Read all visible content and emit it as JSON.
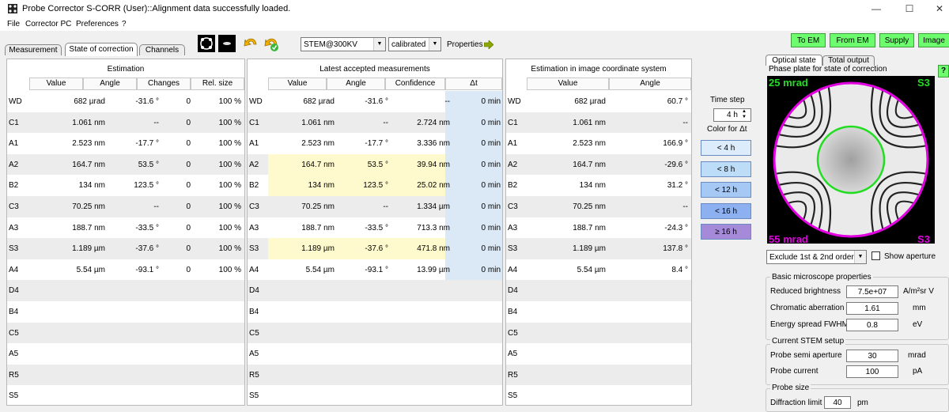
{
  "window": {
    "title": "Probe Corrector S-CORR (User)::Alignment data successfully loaded."
  },
  "menu": [
    "File",
    "Corrector PC",
    "Preferences",
    "?"
  ],
  "tabs": {
    "measurement": "Measurement",
    "state": "State of correction",
    "channels": "Channels"
  },
  "toolbar": {
    "mode": "STEM@300KV",
    "calibration": "calibrated",
    "properties": "Properties",
    "to_em": "To EM",
    "from_em": "From EM",
    "supply": "Supply",
    "image": "Image"
  },
  "estimation": {
    "title": "Estimation",
    "headers": [
      "Value",
      "Angle",
      "Changes",
      "Rel. size"
    ],
    "rows": [
      [
        "WD",
        "682 µrad",
        "-31.6 °",
        "0",
        "100 %"
      ],
      [
        "C1",
        "1.061 nm",
        "--",
        "0",
        "100 %"
      ],
      [
        "A1",
        "2.523 nm",
        "-17.7 °",
        "0",
        "100 %"
      ],
      [
        "A2",
        "164.7 nm",
        "53.5 °",
        "0",
        "100 %"
      ],
      [
        "B2",
        "134 nm",
        "123.5 °",
        "0",
        "100 %"
      ],
      [
        "C3",
        "70.25 nm",
        "--",
        "0",
        "100 %"
      ],
      [
        "A3",
        "188.7 nm",
        "-33.5 °",
        "0",
        "100 %"
      ],
      [
        "S3",
        "1.189 µm",
        "-37.6 °",
        "0",
        "100 %"
      ],
      [
        "A4",
        "5.54 µm",
        "-93.1 °",
        "0",
        "100 %"
      ],
      [
        "D4",
        "",
        "",
        "",
        ""
      ],
      [
        "B4",
        "",
        "",
        "",
        ""
      ],
      [
        "C5",
        "",
        "",
        "",
        ""
      ],
      [
        "A5",
        "",
        "",
        "",
        ""
      ],
      [
        "R5",
        "",
        "",
        "",
        ""
      ],
      [
        "S5",
        "",
        "",
        "",
        ""
      ]
    ]
  },
  "latest": {
    "title": "Latest accepted measurements",
    "headers": [
      "Value",
      "Angle",
      "Confidence",
      "Δt"
    ],
    "rows": [
      [
        "WD",
        "682 µrad",
        "-31.6 °",
        "--",
        "0 min"
      ],
      [
        "C1",
        "1.061 nm",
        "--",
        "2.724 nm",
        "0 min"
      ],
      [
        "A1",
        "2.523 nm",
        "-17.7 °",
        "3.336 nm",
        "0 min"
      ],
      [
        "A2",
        "164.7 nm",
        "53.5 °",
        "39.94 nm",
        "0 min"
      ],
      [
        "B2",
        "134 nm",
        "123.5 °",
        "25.02 nm",
        "0 min"
      ],
      [
        "C3",
        "70.25 nm",
        "--",
        "1.334 µm",
        "0 min"
      ],
      [
        "A3",
        "188.7 nm",
        "-33.5 °",
        "713.3 nm",
        "0 min"
      ],
      [
        "S3",
        "1.189 µm",
        "-37.6 °",
        "471.8 nm",
        "0 min"
      ],
      [
        "A4",
        "5.54 µm",
        "-93.1 °",
        "13.99 µm",
        "0 min"
      ],
      [
        "D4",
        "",
        "",
        "",
        ""
      ],
      [
        "B4",
        "",
        "",
        "",
        ""
      ],
      [
        "C5",
        "",
        "",
        "",
        ""
      ],
      [
        "A5",
        "",
        "",
        "",
        ""
      ],
      [
        "R5",
        "",
        "",
        "",
        ""
      ],
      [
        "S5",
        "",
        "",
        "",
        ""
      ]
    ]
  },
  "image_coord": {
    "title": "Estimation in image coordinate system",
    "headers": [
      "Value",
      "Angle"
    ],
    "rows": [
      [
        "WD",
        "682 µrad",
        "60.7 °"
      ],
      [
        "C1",
        "1.061 nm",
        "--"
      ],
      [
        "A1",
        "2.523 nm",
        "166.9 °"
      ],
      [
        "A2",
        "164.7 nm",
        "-29.6 °"
      ],
      [
        "B2",
        "134 nm",
        "31.2 °"
      ],
      [
        "C3",
        "70.25 nm",
        "--"
      ],
      [
        "A3",
        "188.7 nm",
        "-24.3 °"
      ],
      [
        "S3",
        "1.189 µm",
        "137.8 °"
      ],
      [
        "A4",
        "5.54 µm",
        "8.4 °"
      ],
      [
        "D4",
        "",
        ""
      ],
      [
        "B4",
        "",
        ""
      ],
      [
        "C5",
        "",
        ""
      ],
      [
        "A5",
        "",
        ""
      ],
      [
        "R5",
        "",
        ""
      ],
      [
        "S5",
        "",
        ""
      ]
    ]
  },
  "timestep": {
    "label": "Time step",
    "value": "4 h",
    "color_label": "Color for Δt",
    "buttons": [
      {
        "label": "< 4 h",
        "color": "#dcecfb"
      },
      {
        "label": "< 8 h",
        "color": "#bcdcf8"
      },
      {
        "label": "< 12 h",
        "color": "#a6c8f4"
      },
      {
        "label": "< 16 h",
        "color": "#8cb0f0"
      },
      {
        "label": "≥ 16 h",
        "color": "#a48ad8"
      }
    ]
  },
  "right": {
    "tab_optical": "Optical state",
    "tab_total": "Total output",
    "phase_title": "Phase plate for state of correction",
    "help": "?",
    "mrad_top": "25 mrad",
    "mrad_bottom": "55 mrad",
    "s3_top": "S3",
    "s3_bottom": "S3",
    "exclude": "Exclude 1st & 2nd order",
    "show_aperture": "Show aperture",
    "basic_title": "Basic microscope properties",
    "reduced_brightness_label": "Reduced brightness",
    "reduced_brightness": "7.5e+07",
    "reduced_brightness_unit": "A/m²sr V",
    "chromatic_label": "Chromatic aberration",
    "chromatic": "1.61",
    "chromatic_unit": "mm",
    "energy_label": "Energy spread FWHM",
    "energy": "0.8",
    "energy_unit": "eV",
    "stem_title": "Current STEM setup",
    "aperture_label": "Probe semi aperture",
    "aperture": "30",
    "aperture_unit": "mrad",
    "current_label": "Probe current",
    "current": "100",
    "current_unit": "pA",
    "probe_title": "Probe size",
    "diffraction_label": "Diffraction limit",
    "diffraction": "40",
    "diffraction_unit": "pm"
  },
  "colors": {
    "highlight": "#fffacd",
    "dt_column": "#dbe8f6",
    "green_button": "#6dfc6d",
    "ring_magenta": "#e000e0",
    "ring_green": "#22dd22"
  }
}
